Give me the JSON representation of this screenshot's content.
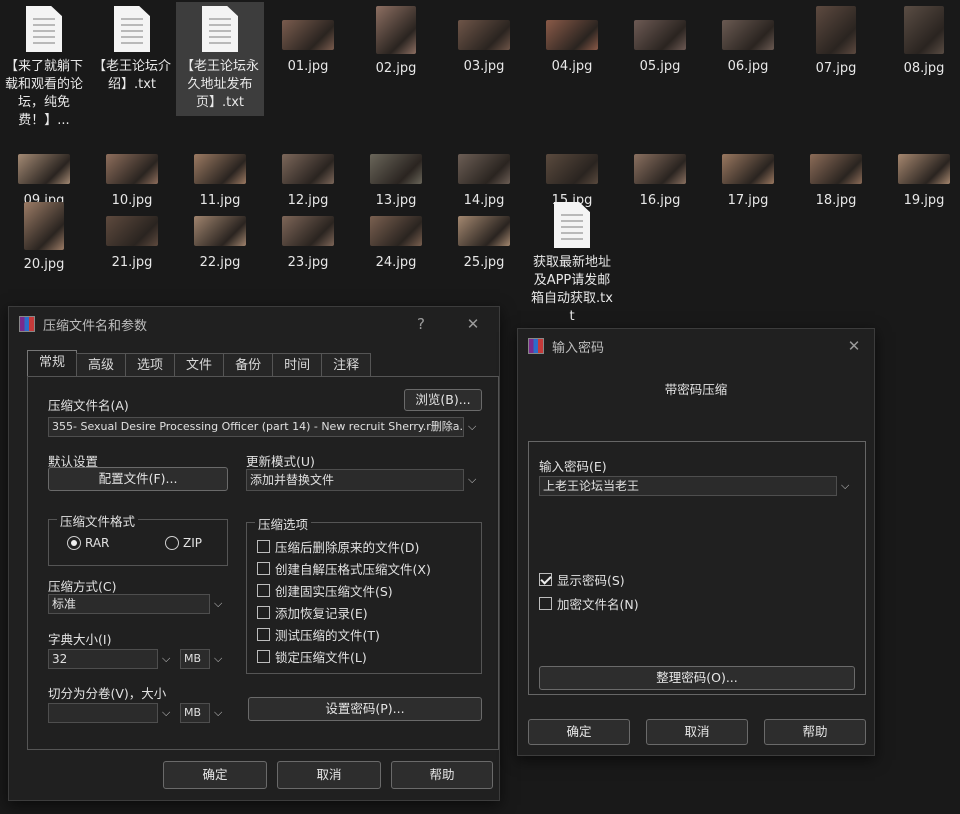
{
  "desktop": {
    "files": [
      {
        "name": "【来了就躺下载和观看的论坛，纯免费！】...",
        "kind": "txt",
        "color": ""
      },
      {
        "name": "【老王论坛介绍】.txt",
        "kind": "txt",
        "color": ""
      },
      {
        "name": "【老王论坛永久地址发布页】.txt",
        "kind": "txt",
        "color": "",
        "selected": true
      },
      {
        "name": "01.jpg",
        "kind": "img",
        "color": "#7a5c4e"
      },
      {
        "name": "02.jpg",
        "kind": "img",
        "color": "#8d6f62",
        "tall": true
      },
      {
        "name": "03.jpg",
        "kind": "img",
        "color": "#6e5548"
      },
      {
        "name": "04.jpg",
        "kind": "img",
        "color": "#8a5a48"
      },
      {
        "name": "05.jpg",
        "kind": "img",
        "color": "#6d5a54"
      },
      {
        "name": "06.jpg",
        "kind": "img",
        "color": "#6a5a52"
      },
      {
        "name": "07.jpg",
        "kind": "img",
        "color": "#5d4a40",
        "tall": true
      },
      {
        "name": "08.jpg",
        "kind": "img",
        "color": "#5a4d44",
        "tall": true
      },
      {
        "name": "09.jpg",
        "kind": "img",
        "color": "#a48a74"
      },
      {
        "name": "10.jpg",
        "kind": "img",
        "color": "#8e6e5c"
      },
      {
        "name": "11.jpg",
        "kind": "img",
        "color": "#9c7a62"
      },
      {
        "name": "12.jpg",
        "kind": "img",
        "color": "#7c675a"
      },
      {
        "name": "13.jpg",
        "kind": "img",
        "color": "#6a665a"
      },
      {
        "name": "14.jpg",
        "kind": "img",
        "color": "#6c5e55"
      },
      {
        "name": "15.jpg",
        "kind": "img",
        "color": "#5a4a3e"
      },
      {
        "name": "16.jpg",
        "kind": "img",
        "color": "#8a7060"
      },
      {
        "name": "17.jpg",
        "kind": "img",
        "color": "#9a7860"
      },
      {
        "name": "18.jpg",
        "kind": "img",
        "color": "#8c6c58"
      },
      {
        "name": "19.jpg",
        "kind": "img",
        "color": "#a6876f"
      },
      {
        "name": "20.jpg",
        "kind": "img",
        "color": "#9c7c66",
        "tall": true
      },
      {
        "name": "21.jpg",
        "kind": "img",
        "color": "#5e4a3e"
      },
      {
        "name": "22.jpg",
        "kind": "img",
        "color": "#a0846e"
      },
      {
        "name": "23.jpg",
        "kind": "img",
        "color": "#7e6658"
      },
      {
        "name": "24.jpg",
        "kind": "img",
        "color": "#7a6050"
      },
      {
        "name": "25.jpg",
        "kind": "img",
        "color": "#a48870"
      },
      {
        "name": "获取最新地址及APP请发邮箱自动获取.txt",
        "kind": "txt",
        "color": ""
      }
    ]
  },
  "archive_dialog": {
    "title": "压缩文件名和参数",
    "help": "?",
    "close": "✕",
    "tabs": [
      "常规",
      "高级",
      "选项",
      "文件",
      "备份",
      "时间",
      "注释"
    ],
    "archive_name_label": "压缩文件名(A)",
    "browse_button": "浏览(B)...",
    "archive_name_value": "355- Sexual Desire Processing Officer (part 14) - New recruit Sherry.r删除a.",
    "default_settings_label": "默认设置",
    "profiles_button": "配置文件(F)...",
    "update_mode_label": "更新模式(U)",
    "update_mode_value": "添加并替换文件",
    "format_group": "压缩文件格式",
    "format_rar": "RAR",
    "format_zip": "ZIP",
    "method_label": "压缩方式(C)",
    "method_value": "标准",
    "dict_label": "字典大小(I)",
    "dict_value": "32",
    "dict_unit": "MB",
    "split_label": "切分为分卷(V)，大小",
    "split_value": "",
    "split_unit": "MB",
    "options_group": "压缩选项",
    "options": [
      {
        "label": "压缩后删除原来的文件(D)",
        "checked": false
      },
      {
        "label": "创建自解压格式压缩文件(X)",
        "checked": false
      },
      {
        "label": "创建固实压缩文件(S)",
        "checked": false
      },
      {
        "label": "添加恢复记录(E)",
        "checked": false
      },
      {
        "label": "测试压缩的文件(T)",
        "checked": false
      },
      {
        "label": "锁定压缩文件(L)",
        "checked": false
      }
    ],
    "set_password_button": "设置密码(P)...",
    "ok_button": "确定",
    "cancel_button": "取消",
    "help_button": "帮助"
  },
  "password_dialog": {
    "title": "输入密码",
    "close": "✕",
    "heading": "带密码压缩",
    "enter_label": "输入密码(E)",
    "password_value": "上老王论坛当老王",
    "show_password": "显示密码(S)",
    "show_password_checked": true,
    "encrypt_names": "加密文件名(N)",
    "encrypt_names_checked": false,
    "organize_button": "整理密码(O)...",
    "ok_button": "确定",
    "cancel_button": "取消",
    "help_button": "帮助"
  },
  "icons": {
    "dropdown": "chevron-down-icon",
    "winrar": "winrar-icon"
  }
}
